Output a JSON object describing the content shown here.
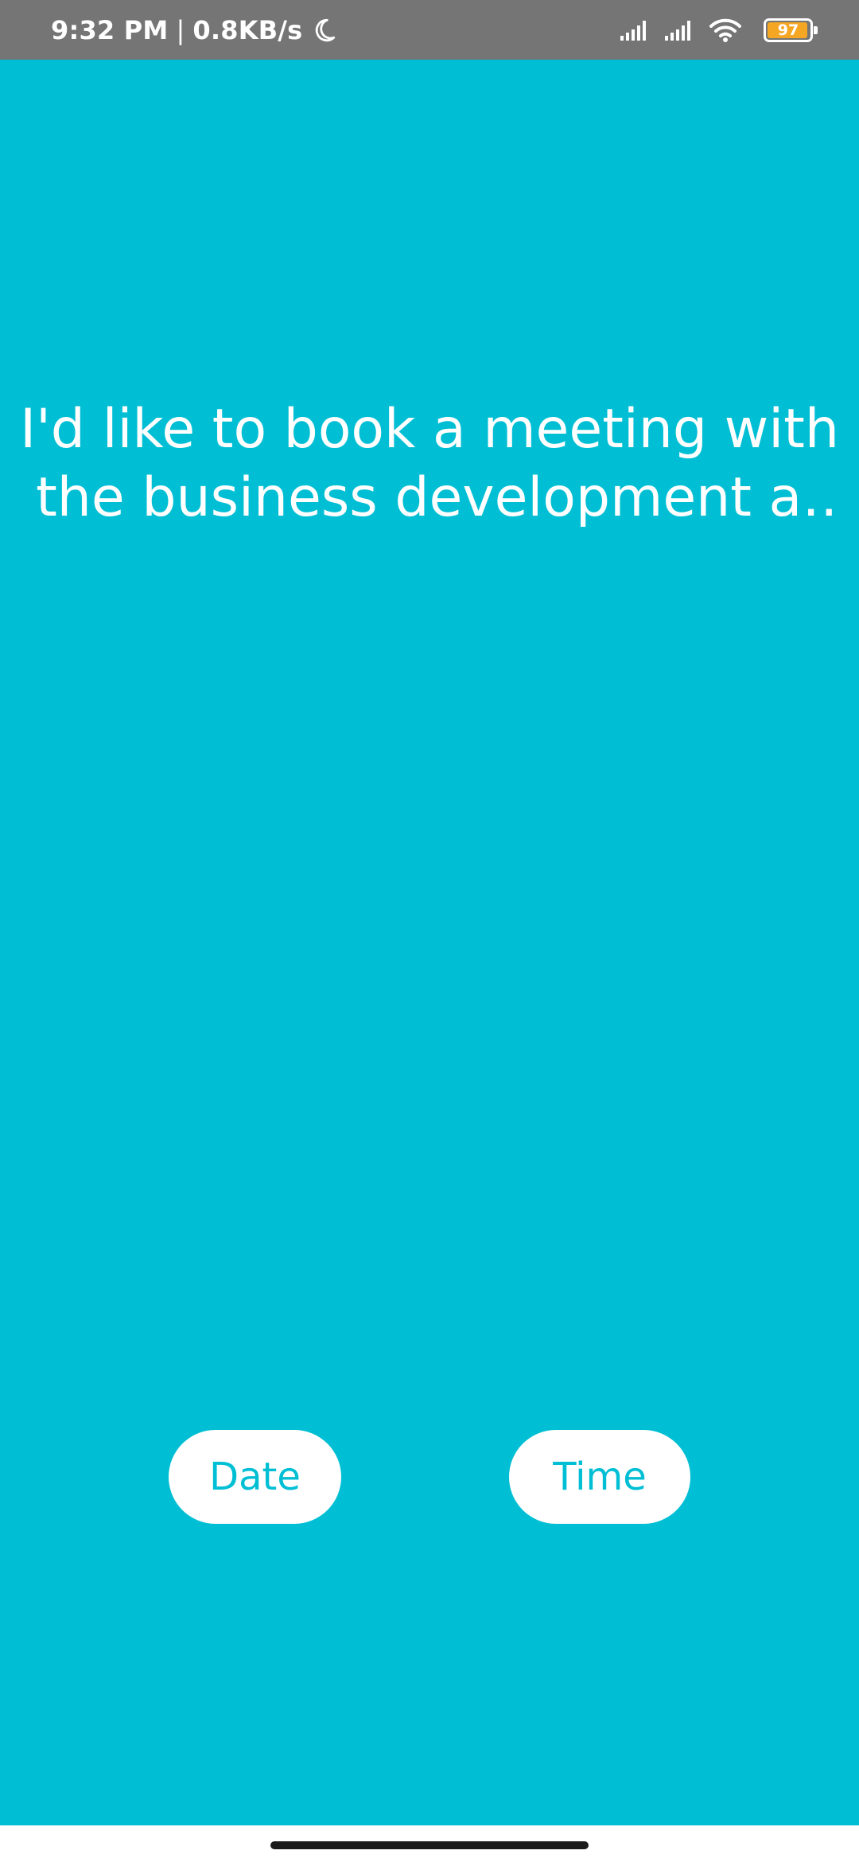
{
  "status_bar": {
    "time": "9:32 PM",
    "separator": "|",
    "network_speed": "0.8KB/s",
    "battery_level": "97",
    "battery_fraction": 0.97,
    "battery_color": "#F5A623",
    "icons": [
      "moon-icon",
      "signal-icon",
      "signal-icon",
      "wifi-icon",
      "battery-icon"
    ]
  },
  "main": {
    "background_color": "#00BFD4",
    "prompt_text": "I'd like to book a meeting with the business development at …",
    "date_button_label": "Date",
    "time_button_label": "Time",
    "button_text_color": "#00BFD4"
  }
}
